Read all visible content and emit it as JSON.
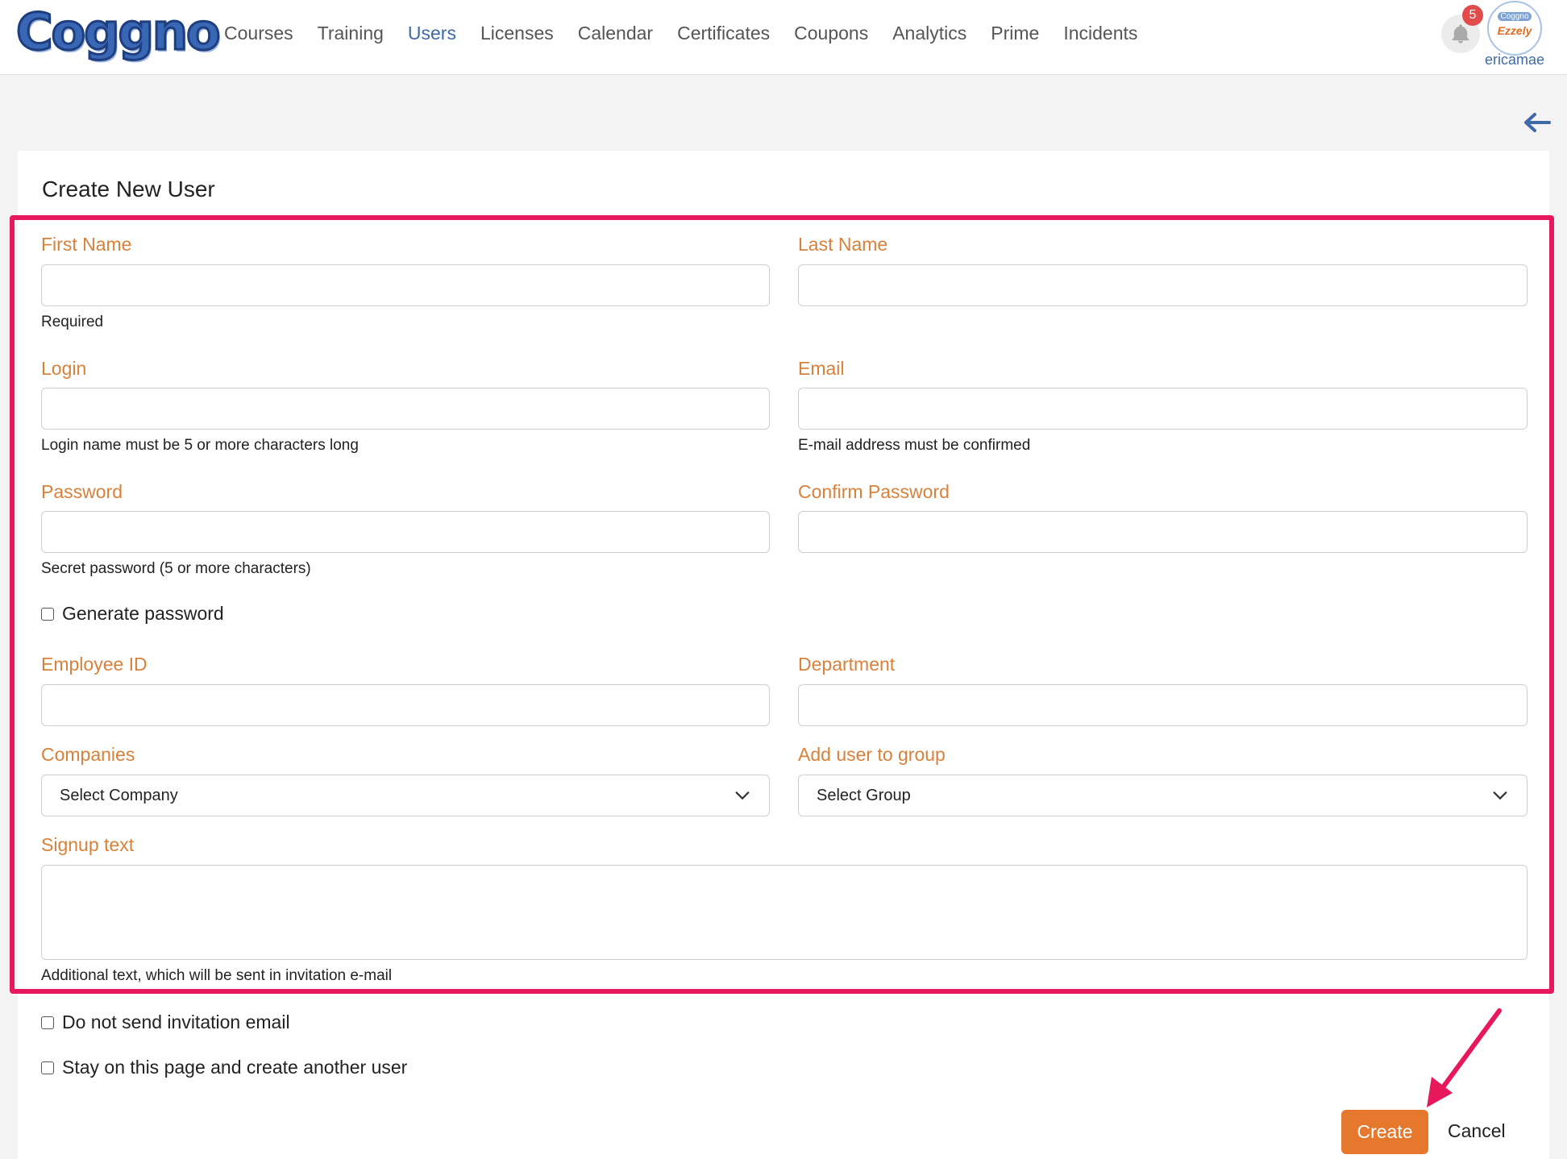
{
  "brand": {
    "logo_text": "Coggno"
  },
  "nav": [
    {
      "label": "Courses",
      "active": false
    },
    {
      "label": "Training",
      "active": false
    },
    {
      "label": "Users",
      "active": true
    },
    {
      "label": "Licenses",
      "active": false
    },
    {
      "label": "Calendar",
      "active": false
    },
    {
      "label": "Certificates",
      "active": false
    },
    {
      "label": "Coupons",
      "active": false
    },
    {
      "label": "Analytics",
      "active": false
    },
    {
      "label": "Prime",
      "active": false
    },
    {
      "label": "Incidents",
      "active": false
    }
  ],
  "header": {
    "notification_count": "5",
    "avatar_top": "Coggno",
    "avatar_bottom": "Ezzely",
    "username": "ericamae",
    "back_icon": "arrow-left-icon"
  },
  "form": {
    "title": "Create New User",
    "first_name": {
      "label": "First Name",
      "value": "",
      "help": "Required"
    },
    "last_name": {
      "label": "Last Name",
      "value": ""
    },
    "login": {
      "label": "Login",
      "value": "",
      "help": "Login name must be 5 or more characters long"
    },
    "email": {
      "label": "Email",
      "value": "",
      "help": "E-mail address must be confirmed"
    },
    "password": {
      "label": "Password",
      "value": "",
      "help": "Secret password (5 or more characters)"
    },
    "confirm_password": {
      "label": "Confirm Password",
      "value": ""
    },
    "generate_password": {
      "label": "Generate password",
      "checked": false
    },
    "employee_id": {
      "label": "Employee ID",
      "value": ""
    },
    "department": {
      "label": "Department",
      "value": ""
    },
    "companies": {
      "label": "Companies",
      "selected": "Select Company"
    },
    "group": {
      "label": "Add user to group",
      "selected": "Select Group"
    },
    "signup_text": {
      "label": "Signup text",
      "value": "",
      "help": "Additional text, which will be sent in invitation e-mail"
    },
    "no_invite": {
      "label": "Do not send invitation email",
      "checked": false
    },
    "stay_on_page": {
      "label": "Stay on this page and create another user",
      "checked": false
    },
    "create_label": "Create",
    "cancel_label": "Cancel"
  },
  "colors": {
    "accent": "#e6782e",
    "label": "#d9813a",
    "link": "#3e6aa8",
    "highlight": "#e8185c"
  }
}
